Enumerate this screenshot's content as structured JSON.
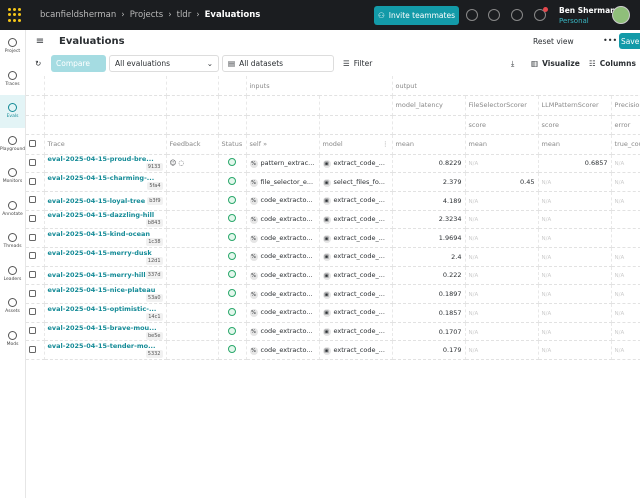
{
  "topbar": {
    "breadcrumbs": [
      "bcanfieldsherman",
      "Projects",
      "tldr",
      "Evaluations"
    ],
    "invite_label": "Invite teammates",
    "user_name": "Ben Sherman",
    "user_sub": "Personal"
  },
  "sidebar": {
    "items": [
      {
        "label": "Project"
      },
      {
        "label": "Traces"
      },
      {
        "label": "Evals",
        "active": true
      },
      {
        "label": "Playground"
      },
      {
        "label": "Monitors"
      },
      {
        "label": "Annotate"
      },
      {
        "label": "Threads"
      },
      {
        "label": "Leaders"
      },
      {
        "label": "Assets"
      },
      {
        "label": "Mods"
      }
    ]
  },
  "header": {
    "title": "Evaluations",
    "reset_label": "Reset view",
    "more_label": "•••",
    "save_label": "Save view"
  },
  "toolbar": {
    "compare_label": "Compare",
    "evaluations_select": "All evaluations",
    "datasets_select": "All datasets",
    "filter_label": "Filter",
    "visualize_label": "Visualize",
    "columns_label": "Columns"
  },
  "table": {
    "group_headers": {
      "inputs": "inputs",
      "output": "output"
    },
    "sub_headers": {
      "model_latency": "model_latency",
      "file_selector": "FileSelectorScorer",
      "llm_pattern": "LLMPatternScorer",
      "precision": "Precision"
    },
    "metric_headers": {
      "score1": "score",
      "score2": "score",
      "error": "error"
    },
    "columns": {
      "trace": "Trace",
      "feedback": "Feedback",
      "status": "Status",
      "self": "self",
      "model": "model",
      "mean1": "mean",
      "mean2": "mean",
      "mean3": "mean",
      "true_count": "true_count"
    },
    "na": "N/A",
    "rows": [
      {
        "trace": "eval-2025-04-15-proud-bre...",
        "hash": "9133",
        "self": "pattern_extrac...",
        "model": "extract_code_...",
        "latency": "0.8229",
        "file_selector": "N/A",
        "llm_pattern": "0.6857",
        "precision": "N/A",
        "feedback": true
      },
      {
        "trace": "eval-2025-04-15-charming-...",
        "hash": "5fa4",
        "self": "file_selector_e...",
        "model": "select_files_fo...",
        "latency": "2.379",
        "file_selector": "0.45",
        "llm_pattern": "N/A",
        "precision": "N/A"
      },
      {
        "trace": "eval-2025-04-15-loyal-tree",
        "hash": "b3f9",
        "self": "code_extracto...",
        "model": "extract_code_...",
        "latency": "4.189",
        "file_selector": "N/A",
        "llm_pattern": "N/A",
        "precision": "N/A"
      },
      {
        "trace": "eval-2025-04-15-dazzling-hill",
        "hash": "b843",
        "self": "code_extracto...",
        "model": "extract_code_...",
        "latency": "2.3234",
        "file_selector": "N/A",
        "llm_pattern": "N/A",
        "precision": ""
      },
      {
        "trace": "eval-2025-04-15-kind-ocean",
        "hash": "1c38",
        "self": "code_extracto...",
        "model": "extract_code_...",
        "latency": "1.9694",
        "file_selector": "N/A",
        "llm_pattern": "N/A",
        "precision": ""
      },
      {
        "trace": "eval-2025-04-15-merry-dusk",
        "hash": "12d1",
        "self": "code_extracto...",
        "model": "extract_code_...",
        "latency": "2.4",
        "file_selector": "N/A",
        "llm_pattern": "N/A",
        "precision": "N/A"
      },
      {
        "trace": "eval-2025-04-15-merry-hill",
        "hash": "337d",
        "self": "code_extracto...",
        "model": "extract_code_...",
        "latency": "0.222",
        "file_selector": "N/A",
        "llm_pattern": "N/A",
        "precision": "N/A"
      },
      {
        "trace": "eval-2025-04-15-nice-plateau",
        "hash": "53a0",
        "self": "code_extracto...",
        "model": "extract_code_...",
        "latency": "0.1897",
        "file_selector": "N/A",
        "llm_pattern": "N/A",
        "precision": "N/A"
      },
      {
        "trace": "eval-2025-04-15-optimistic-...",
        "hash": "14c1",
        "self": "code_extracto...",
        "model": "extract_code_...",
        "latency": "0.1857",
        "file_selector": "N/A",
        "llm_pattern": "N/A",
        "precision": "N/A"
      },
      {
        "trace": "eval-2025-04-15-brave-mou...",
        "hash": "be5e",
        "self": "code_extracto...",
        "model": "extract_code_...",
        "latency": "0.1707",
        "file_selector": "N/A",
        "llm_pattern": "N/A",
        "precision": "N/A"
      },
      {
        "trace": "eval-2025-04-15-tender-mo...",
        "hash": "5332",
        "self": "code_extracto...",
        "model": "extract_code_...",
        "latency": "0.179",
        "file_selector": "N/A",
        "llm_pattern": "N/A",
        "precision": "N/A"
      }
    ]
  },
  "colors": {
    "accent": "#139aa8",
    "topbar": "#1b1d20",
    "success": "#2aa86b"
  }
}
